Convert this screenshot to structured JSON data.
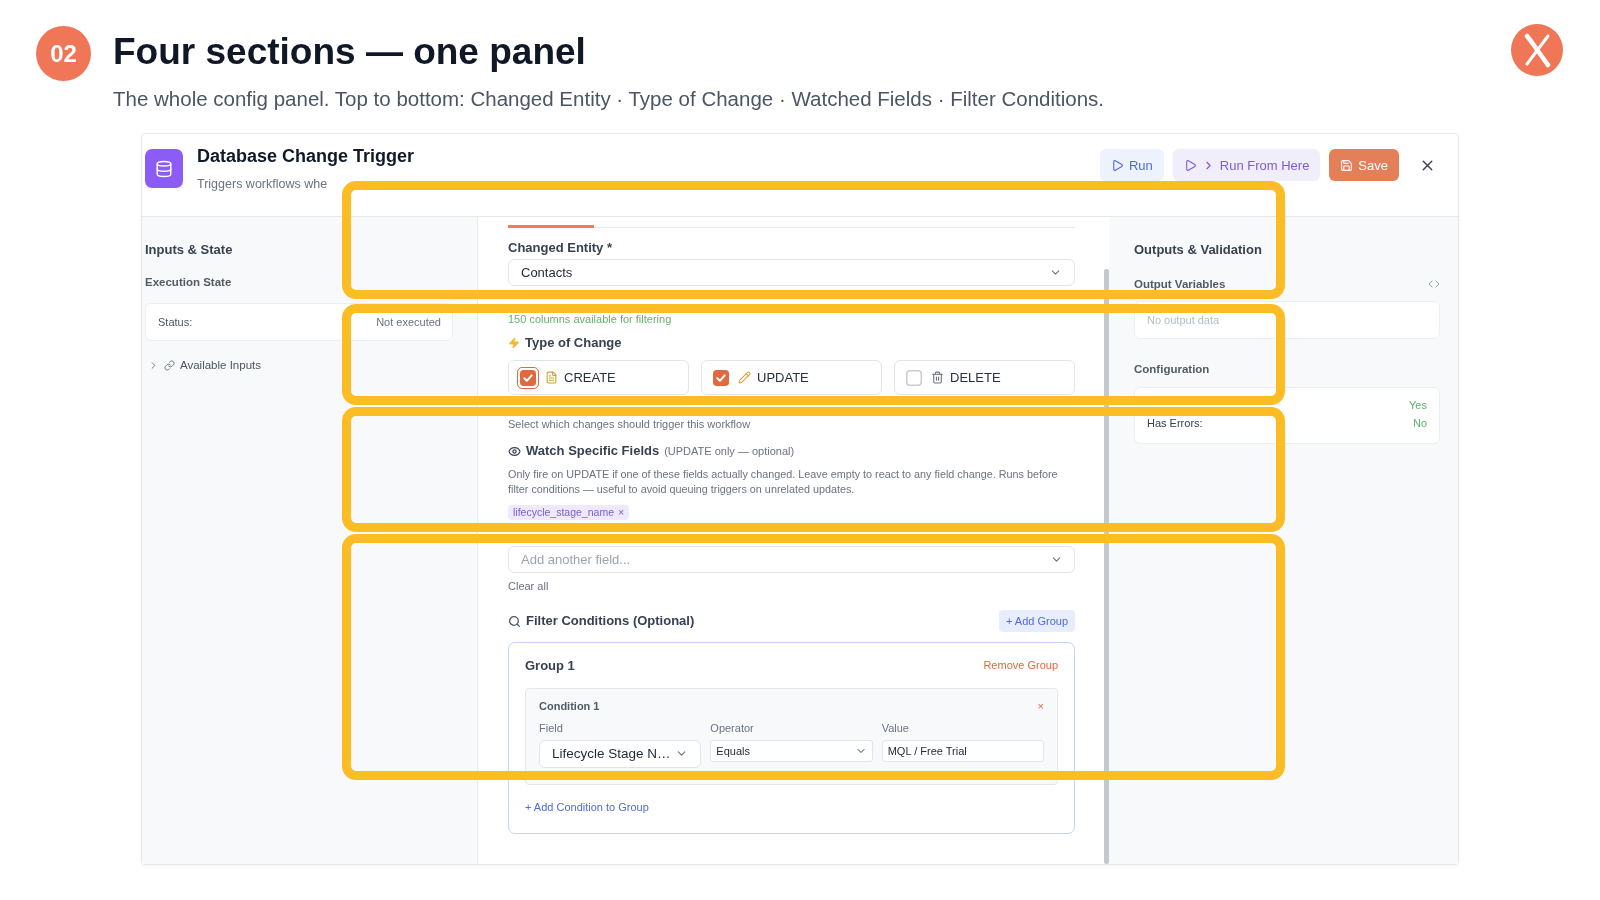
{
  "slide": {
    "number": "02",
    "title": "Four sections — one panel",
    "subtitle": "The whole config panel. Top to bottom: Changed Entity · Type of Change · Watched Fields · Filter Conditions."
  },
  "panel": {
    "title": "Database Change Trigger",
    "subtitle": "Triggers workflows whe",
    "actions": [
      {
        "kind": "run",
        "label": "Run"
      },
      {
        "kind": "run_from_here",
        "label": "Run From Here"
      },
      {
        "kind": "save",
        "label": "Save"
      }
    ]
  },
  "inputs_state": {
    "title": "Inputs & State",
    "execution_state": {
      "label": "Execution State",
      "status_label": "Status:",
      "status_value": "Not executed"
    },
    "available_inputs": {
      "label": "Available Inputs",
      "expanded": false
    }
  },
  "config": {
    "changed_entity": {
      "highlighted": true,
      "label": "Changed Entity *",
      "value": "Contacts",
      "hint": "150 columns available for filtering"
    },
    "type_of_change": {
      "highlighted": true,
      "label": "Type of Change",
      "options": [
        {
          "kind": "create",
          "label": "CREATE",
          "checked": true,
          "focused": true
        },
        {
          "kind": "update",
          "label": "UPDATE",
          "checked": true,
          "focused": false
        },
        {
          "kind": "delete",
          "label": "DELETE",
          "checked": false,
          "focused": false
        }
      ],
      "help": "Select which changes should trigger this workflow"
    },
    "watch_fields": {
      "highlighted": true,
      "title": "Watch Specific Fields",
      "note": "(UPDATE only — optional)",
      "description": "Only fire on UPDATE if one of these fields actually changed. Leave empty to react to any field change. Runs before filter conditions — useful to avoid queuing triggers on unrelated updates.",
      "tags": [
        {
          "label": "lifecycle_stage_name",
          "remove": "×"
        }
      ],
      "add_field": {
        "placeholder": "Add another field..."
      },
      "clear_label": "Clear all"
    },
    "filter_conditions": {
      "highlighted": true,
      "title": "Filter Conditions (Optional)",
      "add_group": "+ Add Group",
      "groups": [
        {
          "title": "Group 1",
          "remove": "Remove Group",
          "conditions": [
            {
              "title": "Condition 1",
              "remove": "×",
              "field": {
                "label": "Field",
                "value": "Lifecycle Stage N…"
              },
              "operator": {
                "label": "Operator",
                "value": "Equals"
              },
              "value": {
                "label": "Value",
                "value": "MQL / Free Trial"
              }
            }
          ],
          "add_condition": "+ Add Condition to Group"
        }
      ]
    }
  },
  "outputs": {
    "title": "Outputs & Validation",
    "output_variables": {
      "label": "Output Variables",
      "empty_message": "No output data"
    },
    "configuration": {
      "label": "Configuration",
      "rows": [
        {
          "value": "Yes"
        },
        {
          "label": "Has Errors:",
          "value": "No"
        }
      ]
    }
  }
}
